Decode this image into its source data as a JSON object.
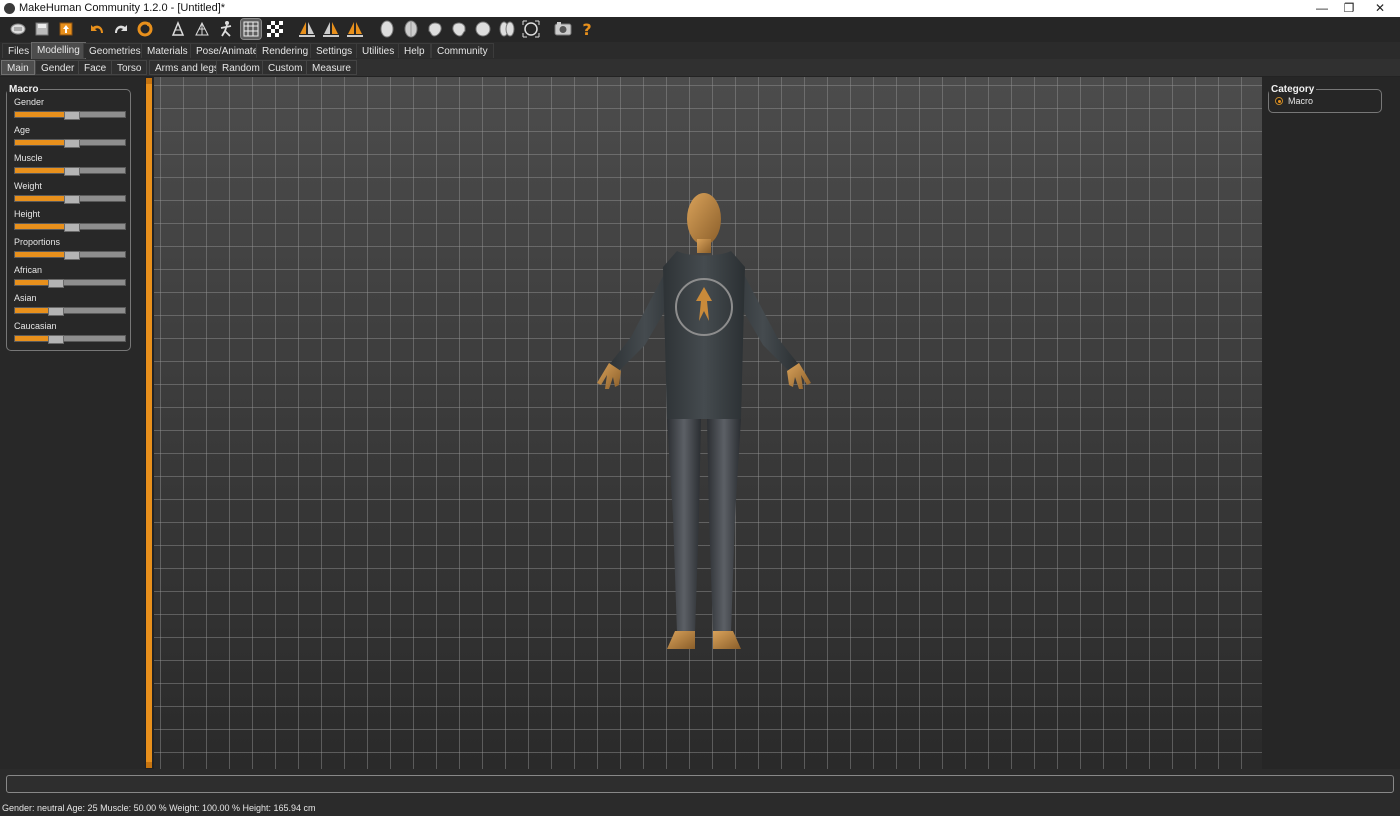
{
  "window": {
    "title": "MakeHuman Community 1.2.0 - [Untitled]*",
    "controls": {
      "minimize": "—",
      "restore": "❐",
      "close": "✕"
    }
  },
  "toolbar": {
    "icons": [
      "new-file-icon",
      "save-icon",
      "export-icon",
      "undo-icon",
      "redo-icon",
      "reset-icon",
      "smooth-icon",
      "wireframe-icon",
      "pose-icon",
      "grid-icon",
      "checkerboard-icon",
      "symmetry-right-icon",
      "symmetry-left-icon",
      "symmetry-icon",
      "front-view-icon",
      "back-view-icon",
      "left-view-icon",
      "right-view-icon",
      "top-view-icon",
      "bottom-view-icon",
      "reset-camera-icon",
      "screenshot-icon",
      "help-icon"
    ],
    "help_glyph": "?"
  },
  "main_tabs": [
    "Files",
    "Modelling",
    "Geometries",
    "Materials",
    "Pose/Animate",
    "Rendering",
    "Settings",
    "Utilities",
    "Help",
    "Community"
  ],
  "main_tab_selected": "Modelling",
  "sub_tabs": [
    "Main",
    "Gender",
    "Face",
    "Torso",
    "Arms and legs",
    "Random",
    "Custom",
    "Measure"
  ],
  "sub_tab_selected": "Main",
  "macro": {
    "title": "Macro",
    "sliders": [
      {
        "label": "Gender",
        "value": 0.5
      },
      {
        "label": "Age",
        "value": 0.5
      },
      {
        "label": "Muscle",
        "value": 0.5
      },
      {
        "label": "Weight",
        "value": 0.5
      },
      {
        "label": "Height",
        "value": 0.5
      },
      {
        "label": "Proportions",
        "value": 0.5
      },
      {
        "label": "African",
        "value": 0.333
      },
      {
        "label": "Asian",
        "value": 0.333
      },
      {
        "label": "Caucasian",
        "value": 0.333
      }
    ]
  },
  "category": {
    "title": "Category",
    "options": [
      {
        "label": "Macro",
        "selected": true
      }
    ]
  },
  "colors": {
    "accent": "#e8901c",
    "background": "#232323",
    "panel": "#282828"
  },
  "status": {
    "text": "Gender: neutral  Age: 25  Muscle: 50.00 %  Weight: 100.00 %  Height: 165.94 cm"
  }
}
